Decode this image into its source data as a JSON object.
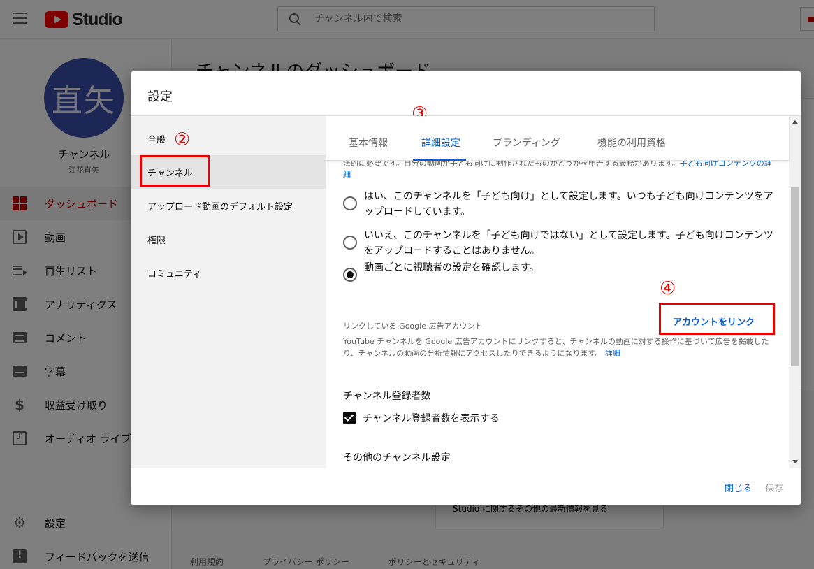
{
  "app": {
    "logo_text": "Studio",
    "search_placeholder": "チャンネル内で検索"
  },
  "sidebar": {
    "avatar_text": "直矢",
    "channel_name": "チャンネル",
    "channel_owner": "江花直矢",
    "items": [
      {
        "label": "ダッシュボード",
        "icon": "dashboard-icon",
        "active": true
      },
      {
        "label": "動画",
        "icon": "video-icon"
      },
      {
        "label": "再生リスト",
        "icon": "playlist-icon"
      },
      {
        "label": "アナリティクス",
        "icon": "analytics-icon"
      },
      {
        "label": "コメント",
        "icon": "comment-icon"
      },
      {
        "label": "字幕",
        "icon": "subtitles-icon"
      },
      {
        "label": "収益受け取り",
        "icon": "dollar-icon"
      },
      {
        "label": "オーディオ ライブ",
        "icon": "audio-library-icon"
      }
    ],
    "bottom_items": [
      {
        "label": "設定",
        "icon": "gear-icon"
      },
      {
        "label": "フィードバックを送信",
        "icon": "feedback-icon"
      }
    ]
  },
  "main": {
    "title": "チャンネルのダッシュボード",
    "card_text": "Studio に関するその他の最新情報を見る",
    "footer_links": [
      "利用規約",
      "プライバシー ポリシー",
      "ポリシーとセキュリティ"
    ]
  },
  "dialog": {
    "title": "設定",
    "side_items": [
      "全般",
      "チャンネル",
      "アップロード動画のデフォルト設定",
      "権限",
      "コミュニティ"
    ],
    "active_side_index": 1,
    "tabs": [
      "基本情報",
      "詳細設定",
      "ブランディング",
      "機能の利用資格"
    ],
    "active_tab_index": 1,
    "cut_text": "法的に必要です。自分の動画が子ども向けに制作されたものかどうかを申告する義務があります。",
    "cut_link": "子ども向けコンテンツの詳細",
    "audience_options": [
      {
        "text": "はい、このチャンネルを「子ども向け」として設定します。いつも子ども向けコンテンツをアップロードしています。",
        "selected": false
      },
      {
        "text": "いいえ、このチャンネルを「子ども向けではない」として設定します。子ども向けコンテンツをアップロードすることはありません。",
        "selected": false
      },
      {
        "text": "動画ごとに視聴者の設定を確認します。",
        "selected": true
      }
    ],
    "google_ads": {
      "label": "リンクしている Google 広告アカウント",
      "link_button": "アカウントをリンク",
      "description": "YouTube チャンネルを Google 広告アカウントにリンクすると、チャンネルの動画に対する操作に基づいて広告を掲載したり、チャンネルの動画の分析情報にアクセスしたりできるようになります。",
      "more_link": "詳細"
    },
    "subscriber_section": {
      "title": "チャンネル登録者数",
      "checkbox_label": "チャンネル登録者数を表示する",
      "checked": true
    },
    "other_section_title": "その他のチャンネル設定",
    "close_button": "閉じる",
    "save_button": "保存"
  },
  "annotations": [
    "②",
    "③",
    "④"
  ],
  "colors": {
    "accent_blue": "#065fd4",
    "youtube_red": "#ff0000",
    "annotation_red": "#e60000",
    "active_red": "#cc0000"
  }
}
